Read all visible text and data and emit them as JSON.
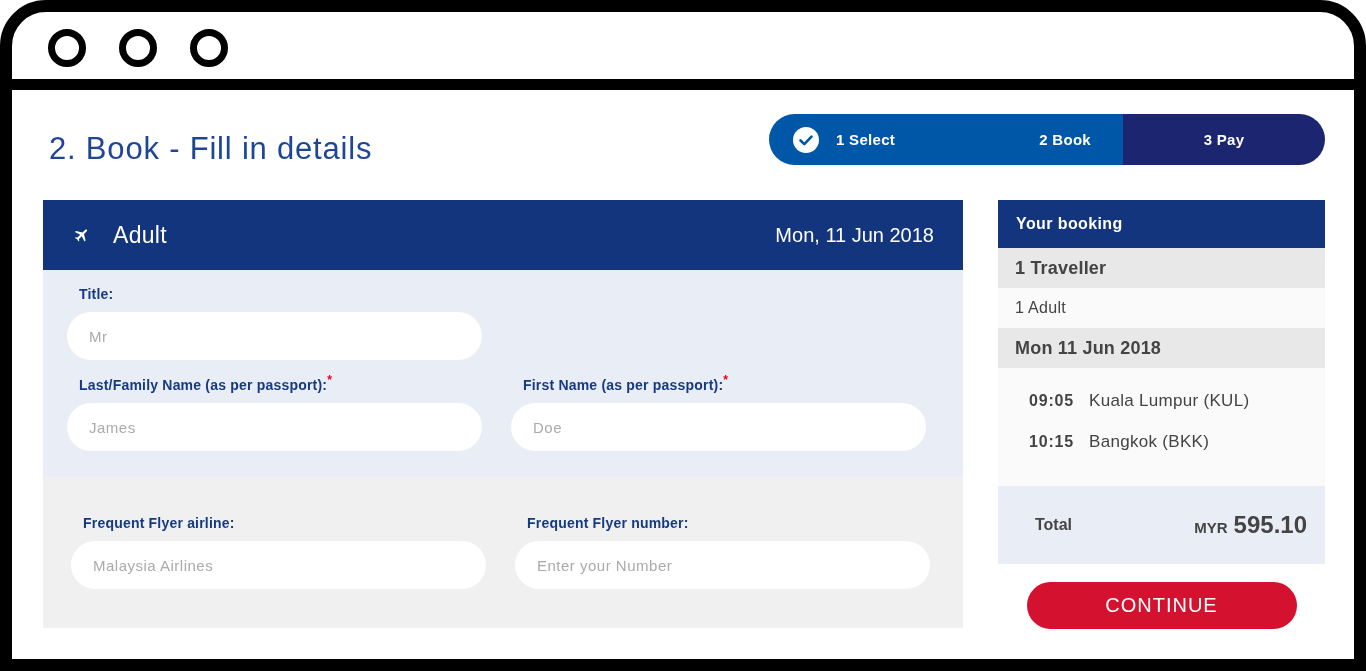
{
  "page": {
    "heading": "2. Book - Fill in details"
  },
  "steps": [
    {
      "label": "1 Select",
      "completed": true,
      "selected": false
    },
    {
      "label": "2 Book",
      "completed": false,
      "selected": true
    },
    {
      "label": "3 Pay",
      "completed": false,
      "selected": false
    }
  ],
  "passenger_card": {
    "title": "Adult",
    "date": "Mon, 11 Jun 2018",
    "sections": [
      {
        "kind": "personal",
        "rows": [
          {
            "fields": [
              {
                "label": "Title:",
                "placeholder": "Mr"
              }
            ]
          },
          {
            "fields": [
              {
                "label": "Last/Family Name (as per passport):$^{*}$",
                "placeholder": "James"
              },
              {
                "label": "First Name (as per passport):$^{*}$",
                "placeholder": "Doe"
              }
            ]
          }
        ]
      },
      {
        "kind": "loyalty",
        "rows": [
          {
            "fields": [
              {
                "label": "Frequent Flyer airline:",
                "placeholder": "Malaysia Airlines"
              },
              {
                "label": "Frequent Flyer number:",
                "placeholder": "Enter your Number"
              }
            ]
          }
        ]
      }
    ]
  },
  "booking_summary": {
    "title": "Your booking",
    "travellers_heading": "1 Traveller",
    "travellers": [
      "1 Adult"
    ],
    "date": "Mon 11 Jun 2018",
    "flight": [
      {
        "time": "09:05",
        "place": "Kuala Lumpur (KUL)"
      },
      {
        "time": "10:15",
        "place": "Bangkok (BKK)"
      }
    ],
    "total_label": "Total",
    "currency": "MYR",
    "amount": "595.10"
  },
  "continue_button": {
    "label": "CONTINUE"
  }
}
